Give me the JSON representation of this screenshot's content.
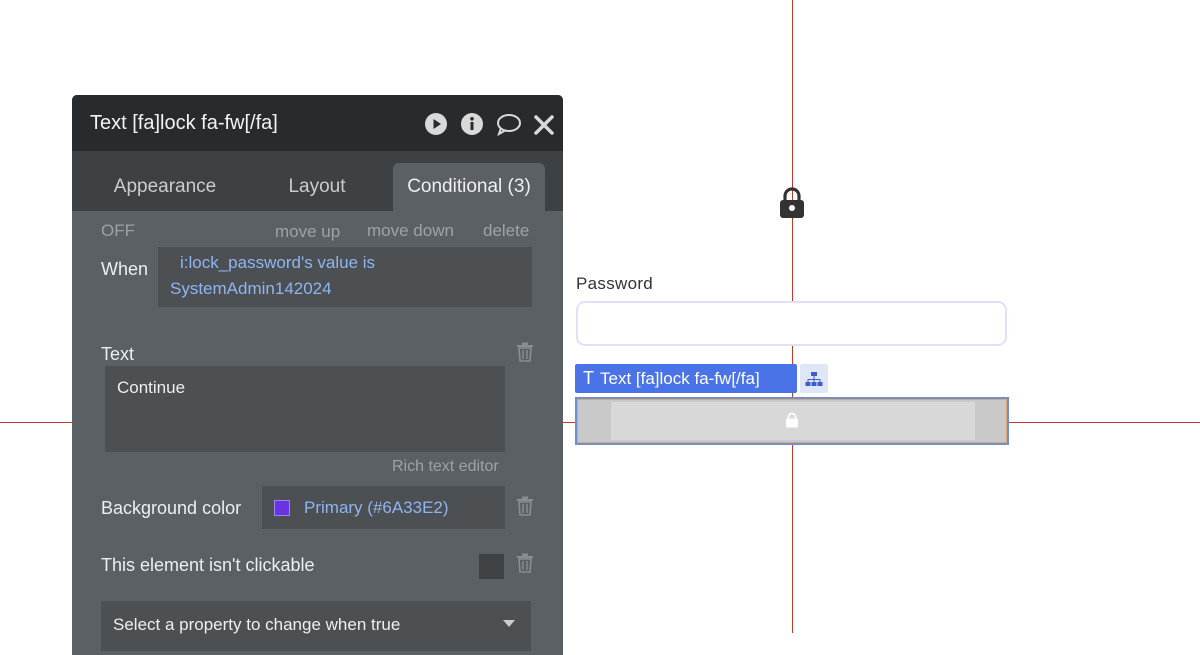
{
  "panel": {
    "title": "Text [fa]lock fa-fw[/fa]",
    "header_icons": [
      "play-icon",
      "info-icon",
      "comment-icon",
      "close-icon"
    ],
    "tabs": [
      {
        "label": "Appearance",
        "active": false
      },
      {
        "label": "Layout",
        "active": false
      },
      {
        "label": "Conditional (3)",
        "active": true
      }
    ],
    "condition": {
      "off_label": "OFF",
      "move_up": "move up",
      "move_down": "move down",
      "delete": "delete",
      "when_label": "When",
      "when_line1": "i:lock_password's value is",
      "when_line2": "SystemAdmin142024"
    },
    "text_prop": {
      "label": "Text",
      "value": "Continue",
      "rich_text_editor": "Rich text editor"
    },
    "background_prop": {
      "label": "Background color",
      "value": "Primary (#6A33E2)",
      "swatch_color": "#6A33E2"
    },
    "clickable_prop": {
      "label": "This element isn't clickable"
    },
    "select_property": {
      "placeholder": "Select a property to change when true"
    }
  },
  "canvas": {
    "password_label": "Password",
    "selected_tag": "Text [fa]lock fa-fw[/fa]",
    "selected_tag_glyph": "T"
  },
  "colors": {
    "accent": "#4a73e8",
    "guide": "#c0392b",
    "panel_bg": "#5b6064",
    "header_bg": "#272b2e",
    "link": "#8fb4f2"
  }
}
